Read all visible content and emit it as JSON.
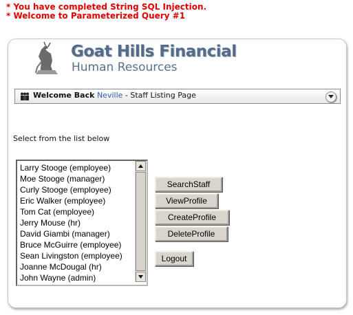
{
  "messages": [
    "* You have completed String SQL Injection.",
    "* Welcome to Parameterized Query #1"
  ],
  "brand": {
    "line1": "Goat Hills Financial",
    "line2": "Human Resources"
  },
  "welcome": {
    "prefix": "Welcome Back",
    "user": "Neville",
    "suffix": " - Staff Listing Page"
  },
  "select_label": "Select from the list below",
  "staff_list": [
    "Larry Stooge (employee)",
    "Moe Stooge (manager)",
    "Curly Stooge (employee)",
    "Eric Walker (employee)",
    "Tom Cat (employee)",
    "Jerry Mouse (hr)",
    "David Giambi (manager)",
    "Bruce McGuirre (employee)",
    "Sean Livingston (employee)",
    "Joanne McDougal (hr)",
    "John Wayne (admin)"
  ],
  "buttons": {
    "search": "SearchStaff",
    "view": "ViewProfile",
    "create": "CreateProfile",
    "delete": "DeleteProfile",
    "logout": "Logout"
  },
  "colors": {
    "message": "#e00000",
    "brand": "#556b8a",
    "user_link": "#2a5db0"
  },
  "icons": [
    "goat-logo-icon",
    "people-icon",
    "collapse-chevron-icon",
    "scroll-up-icon",
    "scroll-down-icon"
  ]
}
